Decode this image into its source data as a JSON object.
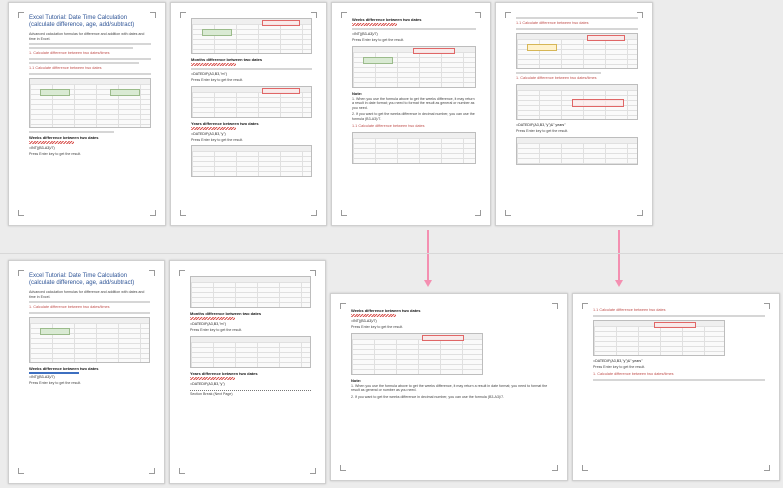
{
  "document": {
    "title": "Excel Tutorial: Date Time Calculation (calculate difference, age, add/subtract)",
    "intro": "Advanced calculation formulas for difference and addition with dates and time in Excel.",
    "toc_label": "1. Calculate difference between two dates/times",
    "link_label": "1.1 Calculate difference between two dates",
    "sections": [
      "Weeks difference between two dates",
      "Months difference between two dates",
      "Years difference between two dates",
      "Days difference between two dates"
    ],
    "formula_weeks": "=INT((B3-A3)/7)",
    "formula_months": "=DATEDIF(A3,B3,\"m\")",
    "formula_years": "=DATEDIF(A3,B3,\"y\")",
    "press_enter": "Press Enter key to get the result.",
    "note_label": "Note:",
    "note_1": "1. When you use the formula above to get the weeks difference, it may return a result in date format; you need to format the result as general or number as you need.",
    "note_2": "2. If you want to get the weeks difference in decimal number, you can use the formula (B3-A3)/7.",
    "datedif_caption": "=DATEDIF(A3,B3,\"y\")&\" years\"",
    "page_marker": "Section Break (Next Page)"
  },
  "colors": {
    "accent": "#2f5597",
    "arrow": "#f48fb1",
    "highlight": "#e06666"
  }
}
